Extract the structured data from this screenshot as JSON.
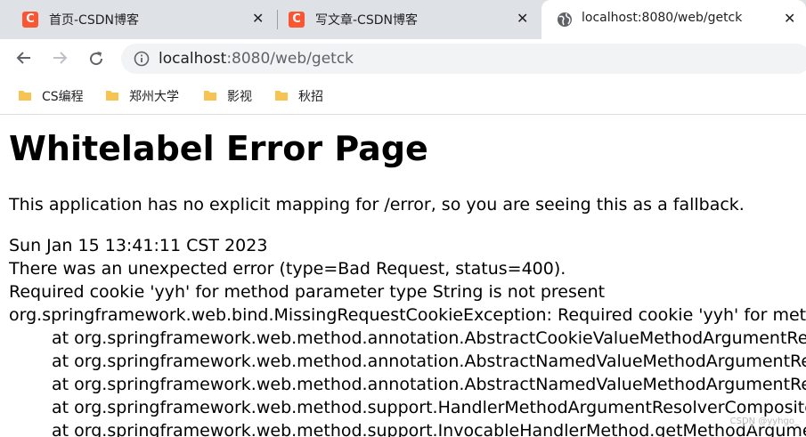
{
  "tabs": [
    {
      "title": "首页-CSDN博客",
      "favicon": "C",
      "active": false
    },
    {
      "title": "写文章-CSDN博客",
      "favicon": "C",
      "active": false
    },
    {
      "title": "localhost:8080/web/getck",
      "favicon": "globe-icon",
      "active": true
    }
  ],
  "tab_close_glyph": "✕",
  "address_bar": {
    "host": "localhost",
    "path": ":8080/web/getck"
  },
  "bookmarks": [
    {
      "label": "CS编程"
    },
    {
      "label": "郑州大学"
    },
    {
      "label": "影视"
    },
    {
      "label": "秋招"
    }
  ],
  "page": {
    "heading": "Whitelabel Error Page",
    "intro": "This application has no explicit mapping for /error, so you are seeing this as a fallback.",
    "timestamp": "Sun Jan 15 13:41:11 CST 2023",
    "error_line": "There was an unexpected error (type=Bad Request, status=400).",
    "message": "Required cookie 'yyh' for method parameter type String is not present",
    "exception": "org.springframework.web.bind.MissingRequestCookieException: Required cookie 'yyh' for method parameter type String is not present",
    "stack": [
      "at org.springframework.web.method.annotation.AbstractCookieValueMethodArgumentResolver",
      "at org.springframework.web.method.annotation.AbstractNamedValueMethodArgumentResolver",
      "at org.springframework.web.method.annotation.AbstractNamedValueMethodArgumentResolver",
      "at org.springframework.web.method.support.HandlerMethodArgumentResolverComposite",
      "at org.springframework.web.method.support.InvocableHandlerMethod.getMethodArgument"
    ]
  },
  "watermark": "CSDN @yyhgo_",
  "colors": {
    "csdn_red": "#fc5531",
    "tabbar_bg": "#dee1e6",
    "folder": "#f5c451"
  }
}
